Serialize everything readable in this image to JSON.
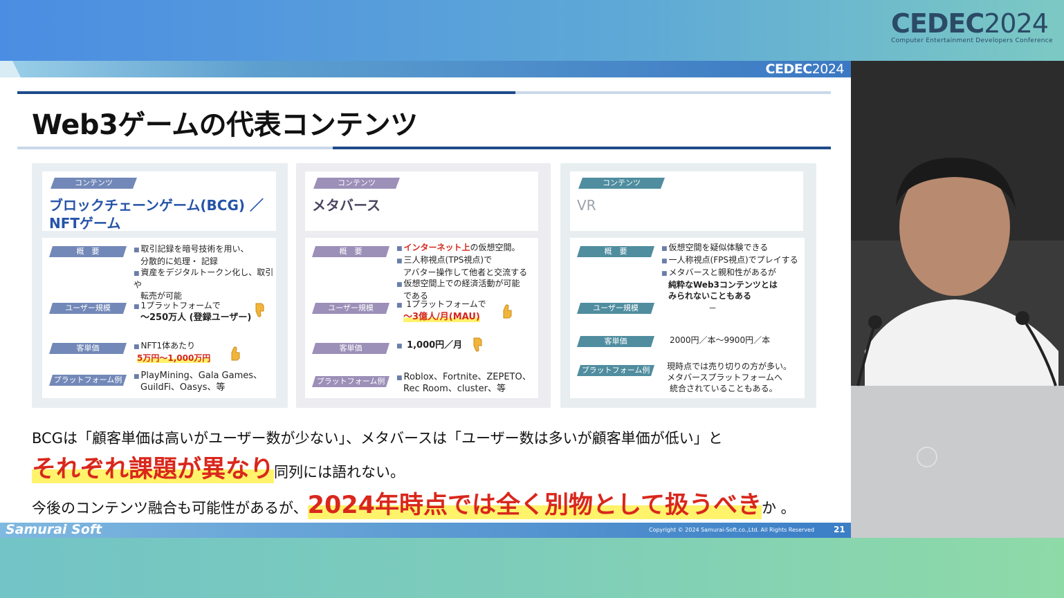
{
  "event": {
    "logo_text": "CEDEC",
    "logo_year": "2024",
    "tagline": "Computer Entertainment Developers Conference"
  },
  "slide": {
    "header_logo_text": "CEDEC",
    "header_logo_year": "2024",
    "title": "Web3ゲームの代表コンテンツ",
    "columns": [
      {
        "tag": "コンテンツ",
        "heading_line1": "ブロックチェーンゲーム(BCG) ／",
        "heading_line2": "NFTゲーム",
        "rows": {
          "overview_label": "概　要",
          "overview": [
            "取引記録を暗号技術を用い、",
            "分散的に処理・ 記録",
            "資産をデジタルトークン化し、取引や",
            "転売が可能"
          ],
          "users_label": "ユーザー規模",
          "users": [
            "1プラットフォームで",
            "～250万人 (登録ユーザー)"
          ],
          "arpu_label": "客単価",
          "arpu": [
            "NFT1体あたり",
            "5万円～1,000万円"
          ],
          "platform_label": "プラットフォーム例",
          "platform": [
            "PlayMining、Gala Games、",
            "GuildFi、Oasys、等"
          ]
        }
      },
      {
        "tag": "コンテンツ",
        "heading_line1": "メタバース",
        "rows": {
          "overview_label": "概　要",
          "overview_red": "インターネット上",
          "overview": [
            "の仮想空間。",
            "三人称視点(TPS視点)で",
            "アバター操作して他者と交流する",
            "仮想空間上での経済活動が可能",
            "である"
          ],
          "users_label": "ユーザー規模",
          "users": [
            "1プラットフォームで",
            "～3億人/月(MAU)"
          ],
          "arpu_label": "客単価",
          "arpu": [
            "1,000円／月"
          ],
          "platform_label": "プラットフォーム例",
          "platform": [
            "Roblox、Fortnite、ZEPETO、",
            "Rec Room、cluster、等"
          ]
        }
      },
      {
        "tag": "コンテンツ",
        "heading_line1": "VR",
        "rows": {
          "overview_label": "概　要",
          "overview": [
            "仮想空間を疑似体験できる",
            "一人称視点(FPS視点)でプレイする",
            "メタバースと親和性があるが",
            "純粋なWeb3コンテンツとは",
            "みられないこともある"
          ],
          "users_label": "ユーザー規模",
          "users": [
            "－"
          ],
          "arpu_label": "客単価",
          "arpu": [
            "2000円／本～9900円／本"
          ],
          "platform_label": "プラットフォーム例",
          "platform": [
            "現時点では売り切りの方が多い。",
            "メタバースプラットフォームへ",
            "統合されていることもある。"
          ]
        }
      }
    ],
    "summary": {
      "line1": "BCGは「顧客単価は高いがユーザー数が少ない」、メタバースは「ユーザー数は多いが顧客単価が低い」と",
      "line2_emph": "それぞれ課題が異なり",
      "line2_rest": "同列には語れない。",
      "line3_lead": "今後のコンテンツ融合も可能性があるが、",
      "line3_emph": "2024年時点では全く別物として扱うべき",
      "line3_tail": "か 。"
    },
    "footer": {
      "brand": "Samurai Soft",
      "copyright": "Copyright © 2024 Samurai-Soft.co.,Ltd. All Rights Reserved",
      "page": "21"
    }
  },
  "colors": {
    "accent_red": "#d9271c",
    "highlight_yellow": "#fff36b",
    "title_navy": "#1e4a8a"
  }
}
